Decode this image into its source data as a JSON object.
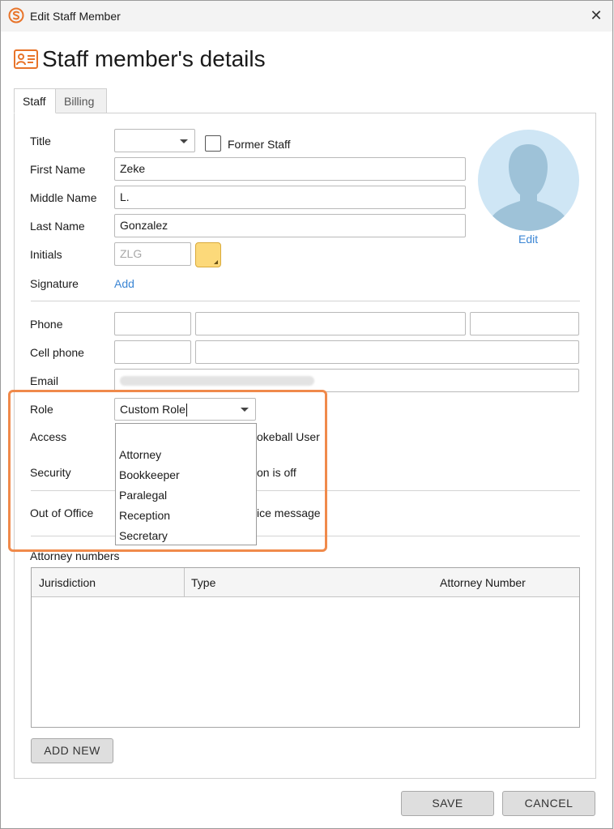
{
  "window": {
    "title": "Edit Staff Member"
  },
  "page": {
    "heading": "Staff member's details"
  },
  "tabs": [
    {
      "label": "Staff"
    },
    {
      "label": "Billing"
    }
  ],
  "form": {
    "title_label": "Title",
    "title_value": "",
    "former_staff_label": "Former Staff",
    "first_name_label": "First Name",
    "first_name_value": "Zeke",
    "middle_name_label": "Middle Name",
    "middle_name_value": "L.",
    "last_name_label": "Last Name",
    "last_name_value": "Gonzalez",
    "initials_label": "Initials",
    "initials_placeholder": "ZLG",
    "initials_color": "#fcd97a",
    "signature_label": "Signature",
    "signature_add": "Add",
    "avatar_edit": "Edit",
    "phone_label": "Phone",
    "cell_phone_label": "Cell phone",
    "email_label": "Email",
    "role_label": "Role",
    "role_value": "Custom Role",
    "access_label": "Access",
    "access_text_partial": "okeball User",
    "security_label": "Security",
    "security_text_partial": "on is off",
    "out_of_office_label": "Out of Office",
    "out_of_office_text_partial": "ice message"
  },
  "role_dropdown": {
    "options": [
      "",
      "Attorney",
      "Bookkeeper",
      "Paralegal",
      "Reception",
      "Secretary"
    ]
  },
  "attorney_numbers": {
    "label": "Attorney numbers",
    "columns": [
      "Jurisdiction",
      "Type",
      "Attorney Number"
    ],
    "rows": []
  },
  "buttons": {
    "add_new": "ADD NEW",
    "save": "SAVE",
    "cancel": "CANCEL"
  },
  "colors": {
    "accent": "#f08a4b",
    "link": "#3b86d4",
    "avatar_bg": "#cfe6f5",
    "avatar_silhouette": "#9ec2d8"
  }
}
